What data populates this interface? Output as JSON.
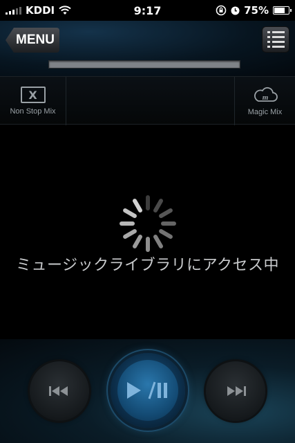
{
  "status_bar": {
    "carrier": "KDDI",
    "time": "9:17",
    "battery_percent": "75%",
    "battery_level": 0.75,
    "icons": [
      "signal-icon",
      "wifi-icon",
      "rotation-lock-icon",
      "alarm-icon",
      "battery-icon"
    ]
  },
  "nav": {
    "menu_label": "MENU",
    "list_icon": "list-icon",
    "progress_level": 0
  },
  "modes": {
    "nonstop_label": "Non Stop Mix",
    "magic_label": "Magic Mix"
  },
  "main": {
    "loading_text": "ミュージックライブラリにアクセス中"
  },
  "controls": {
    "prev_icon": "previous-track-icon",
    "play_icon": "play-pause-icon",
    "next_icon": "next-track-icon"
  },
  "colors": {
    "accent_blue": "#2a77ac",
    "progress_track": "#7f8388",
    "text_gray": "#c9cbcd"
  }
}
